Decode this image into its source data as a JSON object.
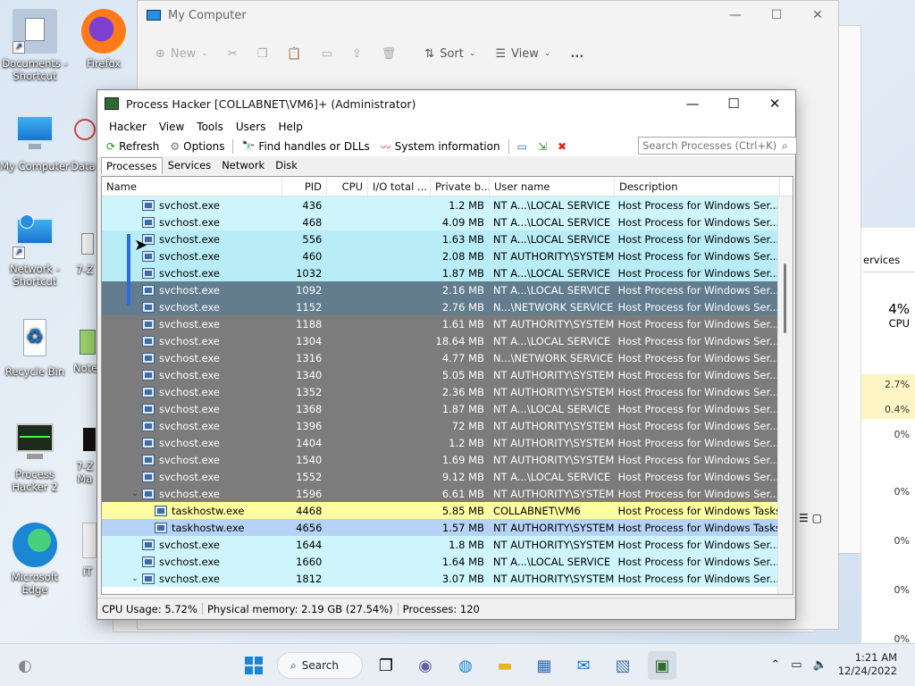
{
  "desktop_icons": [
    {
      "label": "Documents - Shortcut"
    },
    {
      "label": "Firefox"
    },
    {
      "label": "My Computer"
    },
    {
      "label": "Data"
    },
    {
      "label": "Network - Shortcut"
    },
    {
      "label": "7-Z"
    },
    {
      "label": "Recycle Bin"
    },
    {
      "label": "Note"
    },
    {
      "label": "Process Hacker 2"
    },
    {
      "label": "7-Z Ma"
    },
    {
      "label": "Microsoft Edge"
    },
    {
      "label": "iT"
    }
  ],
  "mycomputer": {
    "title": "My Computer",
    "toolbar": {
      "new": "New",
      "sort": "Sort",
      "view": "View",
      "more": "..."
    }
  },
  "taskmanager_partial": {
    "tab": "ervices",
    "cpu_pct": "4%",
    "cpu_label": "CPU",
    "values": [
      "2.7%",
      "0.4%",
      "0%",
      "0%",
      "0%",
      "0%",
      "0%",
      "0%"
    ]
  },
  "ph": {
    "title": "Process Hacker [COLLABNET\\VM6]+ (Administrator)",
    "menu": [
      "Hacker",
      "View",
      "Tools",
      "Users",
      "Help"
    ],
    "toolbar": {
      "refresh": "Refresh",
      "options": "Options",
      "find_handles": "Find handles or DLLs",
      "sysinfo": "System information"
    },
    "search_placeholder": "Search Processes (Ctrl+K)",
    "tabs": [
      "Processes",
      "Services",
      "Network",
      "Disk"
    ],
    "columns": {
      "name": "Name",
      "pid": "PID",
      "cpu": "CPU",
      "io": "I/O total ...",
      "priv": "Private b...",
      "user": "User name",
      "desc": "Description"
    },
    "rows": [
      {
        "name": "svchost.exe",
        "pid": "436",
        "priv": "1.2 MB",
        "user": "NT A...\\LOCAL SERVICE",
        "desc": "Host Process for Windows Ser..."
      },
      {
        "name": "svchost.exe",
        "pid": "468",
        "priv": "4.09 MB",
        "user": "NT A...\\LOCAL SERVICE",
        "desc": "Host Process for Windows Ser..."
      },
      {
        "name": "svchost.exe",
        "pid": "556",
        "priv": "1.63 MB",
        "user": "NT A...\\LOCAL SERVICE",
        "desc": "Host Process for Windows Ser..."
      },
      {
        "name": "svchost.exe",
        "pid": "460",
        "priv": "2.08 MB",
        "user": "NT AUTHORITY\\SYSTEM",
        "desc": "Host Process for Windows Ser..."
      },
      {
        "name": "svchost.exe",
        "pid": "1032",
        "priv": "1.87 MB",
        "user": "NT A...\\LOCAL SERVICE",
        "desc": "Host Process for Windows Ser..."
      },
      {
        "name": "svchost.exe",
        "pid": "1092",
        "priv": "2.16 MB",
        "user": "NT A...\\LOCAL SERVICE",
        "desc": "Host Process for Windows Ser..."
      },
      {
        "name": "svchost.exe",
        "pid": "1152",
        "priv": "2.76 MB",
        "user": "N...\\NETWORK SERVICE",
        "desc": "Host Process for Windows Ser..."
      },
      {
        "name": "svchost.exe",
        "pid": "1188",
        "priv": "1.61 MB",
        "user": "NT AUTHORITY\\SYSTEM",
        "desc": "Host Process for Windows Ser..."
      },
      {
        "name": "svchost.exe",
        "pid": "1304",
        "priv": "18.64 MB",
        "user": "NT A...\\LOCAL SERVICE",
        "desc": "Host Process for Windows Ser..."
      },
      {
        "name": "svchost.exe",
        "pid": "1316",
        "priv": "4.77 MB",
        "user": "N...\\NETWORK SERVICE",
        "desc": "Host Process for Windows Ser..."
      },
      {
        "name": "svchost.exe",
        "pid": "1340",
        "priv": "5.05 MB",
        "user": "NT AUTHORITY\\SYSTEM",
        "desc": "Host Process for Windows Ser..."
      },
      {
        "name": "svchost.exe",
        "pid": "1352",
        "priv": "2.36 MB",
        "user": "NT AUTHORITY\\SYSTEM",
        "desc": "Host Process for Windows Ser..."
      },
      {
        "name": "svchost.exe",
        "pid": "1368",
        "priv": "1.87 MB",
        "user": "NT A...\\LOCAL SERVICE",
        "desc": "Host Process for Windows Ser..."
      },
      {
        "name": "svchost.exe",
        "pid": "1396",
        "priv": "72 MB",
        "user": "NT AUTHORITY\\SYSTEM",
        "desc": "Host Process for Windows Ser..."
      },
      {
        "name": "svchost.exe",
        "pid": "1404",
        "priv": "1.2 MB",
        "user": "NT AUTHORITY\\SYSTEM",
        "desc": "Host Process for Windows Ser..."
      },
      {
        "name": "svchost.exe",
        "pid": "1540",
        "priv": "1.69 MB",
        "user": "NT AUTHORITY\\SYSTEM",
        "desc": "Host Process for Windows Ser..."
      },
      {
        "name": "svchost.exe",
        "pid": "1552",
        "priv": "9.12 MB",
        "user": "NT A...\\LOCAL SERVICE",
        "desc": "Host Process for Windows Ser..."
      },
      {
        "name": "svchost.exe",
        "pid": "1596",
        "priv": "6.61 MB",
        "user": "NT AUTHORITY\\SYSTEM",
        "desc": "Host Process for Windows Ser..."
      },
      {
        "name": "taskhostw.exe",
        "pid": "4468",
        "priv": "5.85 MB",
        "user": "COLLABNET\\VM6",
        "desc": "Host Process for Windows Tasks"
      },
      {
        "name": "taskhostw.exe",
        "pid": "4656",
        "priv": "1.57 MB",
        "user": "NT AUTHORITY\\SYSTEM",
        "desc": "Host Process for Windows Tasks"
      },
      {
        "name": "svchost.exe",
        "pid": "1644",
        "priv": "1.8 MB",
        "user": "NT AUTHORITY\\SYSTEM",
        "desc": "Host Process for Windows Ser..."
      },
      {
        "name": "svchost.exe",
        "pid": "1660",
        "priv": "1.64 MB",
        "user": "NT A...\\LOCAL SERVICE",
        "desc": "Host Process for Windows Ser..."
      },
      {
        "name": "svchost.exe",
        "pid": "1812",
        "priv": "3.07 MB",
        "user": "NT AUTHORITY\\SYSTEM",
        "desc": "Host Process for Windows Ser..."
      }
    ],
    "status": {
      "cpu": "CPU Usage: 5.72%",
      "mem": "Physical memory: 2.19 GB (27.54%)",
      "procs": "Processes: 120"
    }
  },
  "taskbar": {
    "search": "Search",
    "time": "1:21 AM",
    "date": "12/24/2022"
  },
  "colors": {
    "row_cyan": "#cdf5fb",
    "row_selected": "#637d8f",
    "row_gray": "#7c7c7c",
    "row_yellow": "#fefea0",
    "row_blue": "#b6d3f7"
  }
}
